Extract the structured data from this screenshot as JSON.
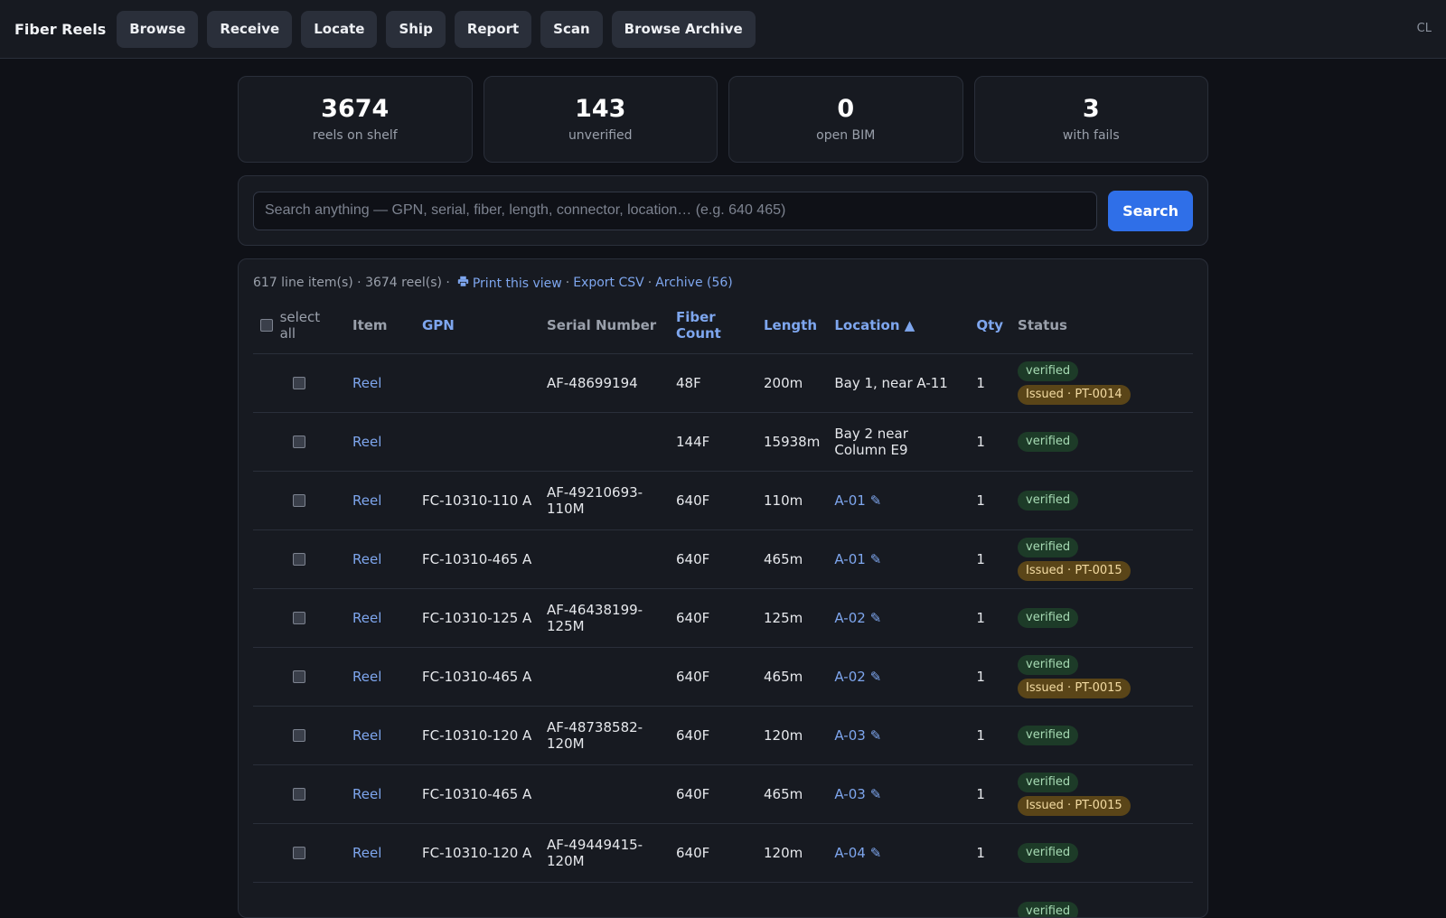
{
  "header": {
    "brand": "Fiber Reels",
    "nav": [
      "Browse",
      "Receive",
      "Locate",
      "Ship",
      "Report",
      "Scan",
      "Browse Archive"
    ],
    "user_initials": "CL"
  },
  "stats": [
    {
      "value": "3674",
      "label": "reels on shelf"
    },
    {
      "value": "143",
      "label": "unverified"
    },
    {
      "value": "0",
      "label": "open BIM"
    },
    {
      "value": "3",
      "label": "with fails"
    }
  ],
  "search": {
    "placeholder": "Search anything — GPN, serial, fiber, length, connector, location… (e.g. 640 465)",
    "value": "",
    "button_label": "Search"
  },
  "results": {
    "summary": "617 line item(s) · 3674 reel(s) ·",
    "print_label": "Print this view",
    "export_label": "Export CSV",
    "archive_label": "Archive (56)",
    "select_all_label": "select all",
    "columns": {
      "item": "Item",
      "gpn": "GPN",
      "serial": "Serial Number",
      "fiber_line1": "Fiber",
      "fiber_line2": "Count",
      "length": "Length",
      "location": "Location ▲",
      "qty": "Qty",
      "status": "Status"
    },
    "edit_icon": "✎",
    "rows": [
      {
        "item": "Reel",
        "gpn": "",
        "serial": "AF-48699194",
        "fiber": "48F",
        "length": "200m",
        "location": "Bay 1, near A-11",
        "location_link": false,
        "qty": "1",
        "verified": "verified",
        "issued": "Issued · PT-0014"
      },
      {
        "item": "Reel",
        "gpn": "",
        "serial": "",
        "fiber": "144F",
        "length": "15938m",
        "location": "Bay 2 near Column E9",
        "location_link": false,
        "qty": "1",
        "verified": "verified",
        "issued": ""
      },
      {
        "item": "Reel",
        "gpn": "FC-10310-110 A",
        "serial": "AF-49210693-110M",
        "fiber": "640F",
        "length": "110m",
        "location": "A-01",
        "location_link": true,
        "qty": "1",
        "verified": "verified",
        "issued": ""
      },
      {
        "item": "Reel",
        "gpn": "FC-10310-465 A",
        "serial": "",
        "fiber": "640F",
        "length": "465m",
        "location": "A-01",
        "location_link": true,
        "qty": "1",
        "verified": "verified",
        "issued": "Issued · PT-0015"
      },
      {
        "item": "Reel",
        "gpn": "FC-10310-125 A",
        "serial": "AF-46438199-125M",
        "fiber": "640F",
        "length": "125m",
        "location": "A-02",
        "location_link": true,
        "qty": "1",
        "verified": "verified",
        "issued": ""
      },
      {
        "item": "Reel",
        "gpn": "FC-10310-465 A",
        "serial": "",
        "fiber": "640F",
        "length": "465m",
        "location": "A-02",
        "location_link": true,
        "qty": "1",
        "verified": "verified",
        "issued": "Issued · PT-0015"
      },
      {
        "item": "Reel",
        "gpn": "FC-10310-120 A",
        "serial": "AF-48738582-120M",
        "fiber": "640F",
        "length": "120m",
        "location": "A-03",
        "location_link": true,
        "qty": "1",
        "verified": "verified",
        "issued": ""
      },
      {
        "item": "Reel",
        "gpn": "FC-10310-465 A",
        "serial": "",
        "fiber": "640F",
        "length": "465m",
        "location": "A-03",
        "location_link": true,
        "qty": "1",
        "verified": "verified",
        "issued": "Issued · PT-0015"
      },
      {
        "item": "Reel",
        "gpn": "FC-10310-120 A",
        "serial": "AF-49449415-120M",
        "fiber": "640F",
        "length": "120m",
        "location": "A-04",
        "location_link": true,
        "qty": "1",
        "verified": "verified",
        "issued": ""
      },
      {
        "item": "",
        "gpn": "",
        "serial": "",
        "fiber": "",
        "length": "",
        "location": "",
        "location_link": false,
        "qty": "",
        "verified": "verified",
        "issued": ""
      }
    ]
  },
  "colors": {
    "background": "#0f1117",
    "panel": "#171a21",
    "accent": "#2f6fe8",
    "link": "#7ea6ee",
    "verified_bg": "#1d3b28",
    "issued_bg": "#5a4518"
  }
}
